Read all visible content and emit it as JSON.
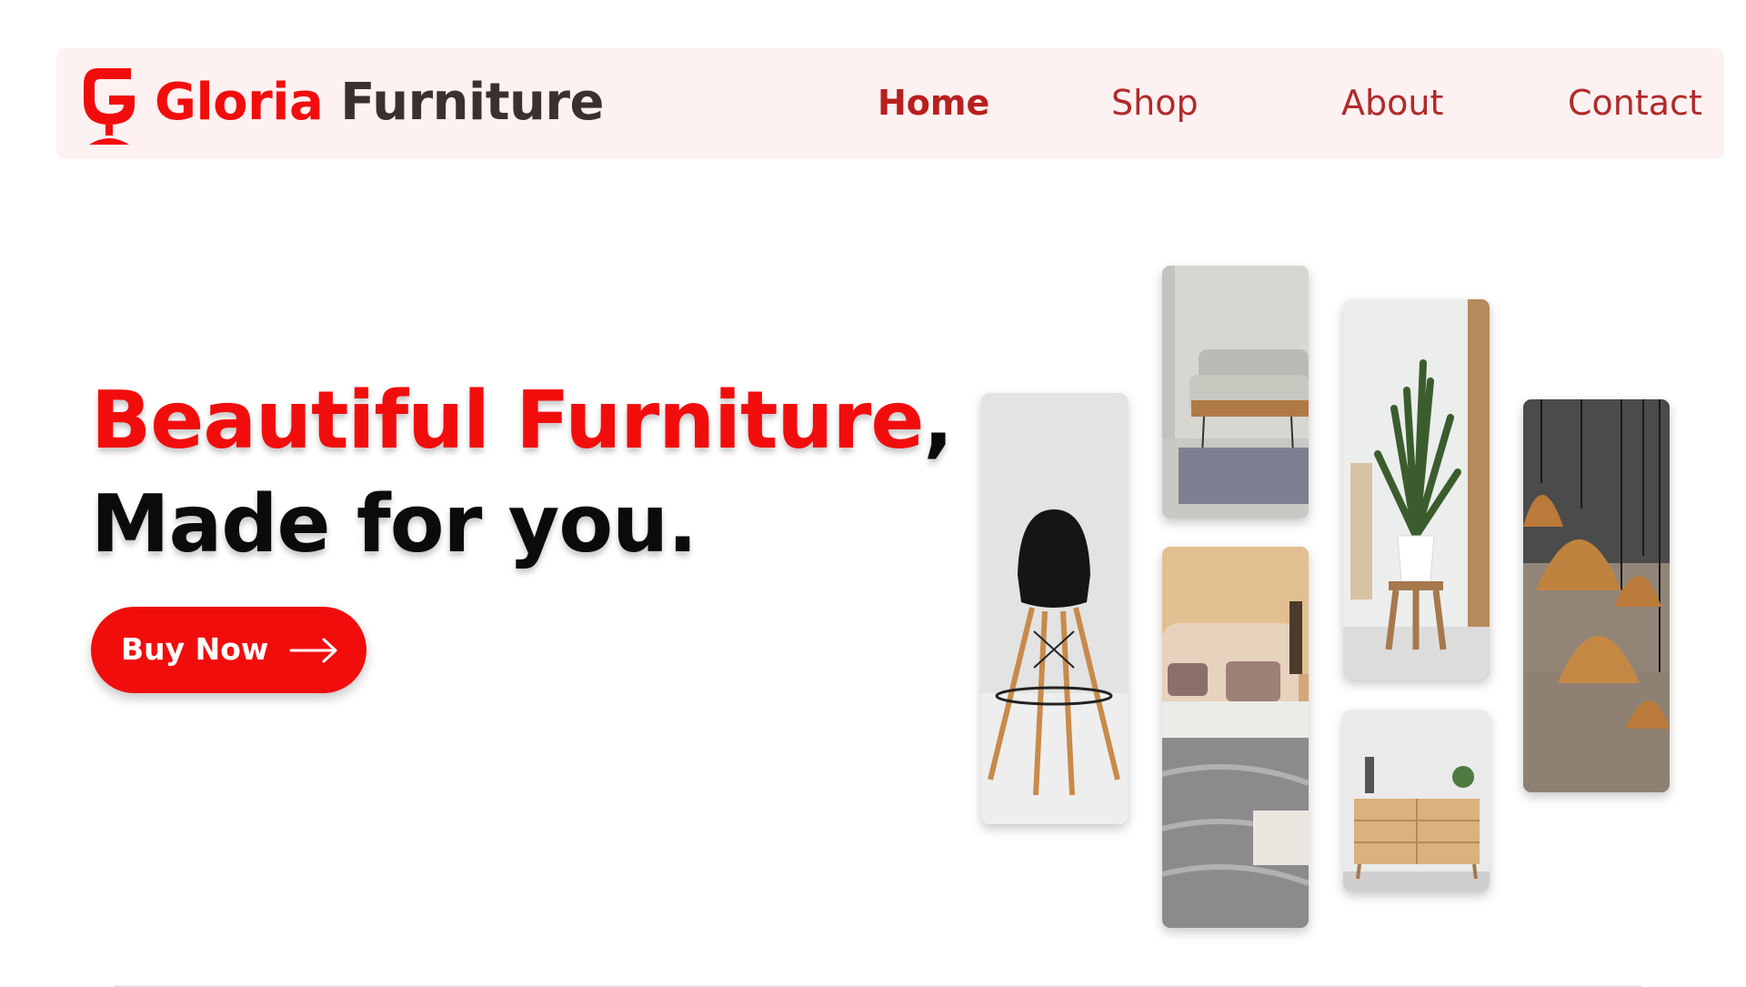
{
  "brand": {
    "name_part1": "Gloria",
    "name_part2": "Furniture",
    "color": "#f20d0d"
  },
  "nav": {
    "items": [
      {
        "label": "Home",
        "active": true
      },
      {
        "label": "Shop",
        "active": false
      },
      {
        "label": "About",
        "active": false
      },
      {
        "label": "Contact",
        "active": false
      }
    ]
  },
  "hero": {
    "title_highlight": "Beautiful Furniture",
    "title_comma": ",",
    "title_line2": "Made for you.",
    "cta_label": "Buy Now",
    "cta_icon": "arrow-right-icon"
  },
  "gallery": {
    "images": [
      "bar-stool",
      "living-room-sofa-table",
      "bedroom-bed",
      "snake-plant-stand",
      "wooden-sideboard",
      "copper-pendant-lamps"
    ]
  },
  "colors": {
    "accent": "#f20d0d",
    "nav_bg": "#fdf1f1",
    "nav_text": "#b12a2a",
    "dark_text": "#0b0b0b"
  }
}
